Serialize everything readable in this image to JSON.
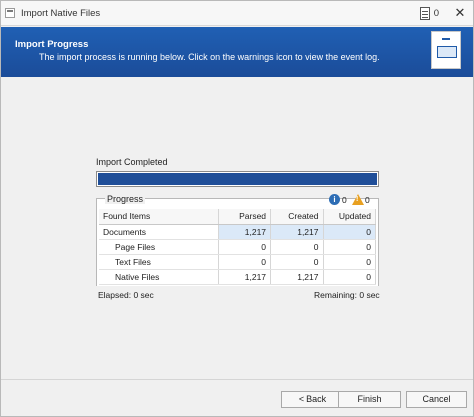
{
  "window": {
    "title": "Import Native Files",
    "title_count": "0"
  },
  "banner": {
    "title": "Import Progress",
    "subtitle": "The import process is running below. Click on the warnings icon to view the event log."
  },
  "progress": {
    "label": "Import Completed",
    "fraction": 1.0,
    "group_title": "Progress",
    "info_count": "0",
    "warning_count": "0"
  },
  "table": {
    "columns": [
      "Found Items",
      "Parsed",
      "Created",
      "Updated"
    ],
    "rows": [
      {
        "item": "Documents",
        "parsed": "1,217",
        "created": "1,217",
        "updated": "0"
      },
      {
        "item": "Page Files",
        "parsed": "0",
        "created": "0",
        "updated": "0"
      },
      {
        "item": "Text Files",
        "parsed": "0",
        "created": "0",
        "updated": "0"
      },
      {
        "item": "Native Files",
        "parsed": "1,217",
        "created": "1,217",
        "updated": "0"
      }
    ]
  },
  "status": {
    "elapsed": "Elapsed: 0 sec",
    "remaining": "Remaining: 0 sec"
  },
  "buttons": {
    "back": "Back",
    "finish": "Finish",
    "cancel": "Cancel"
  },
  "colors": {
    "banner": "#1f55a6",
    "progress_fill": "#1f4e98",
    "selection": "#dbe9f8"
  }
}
